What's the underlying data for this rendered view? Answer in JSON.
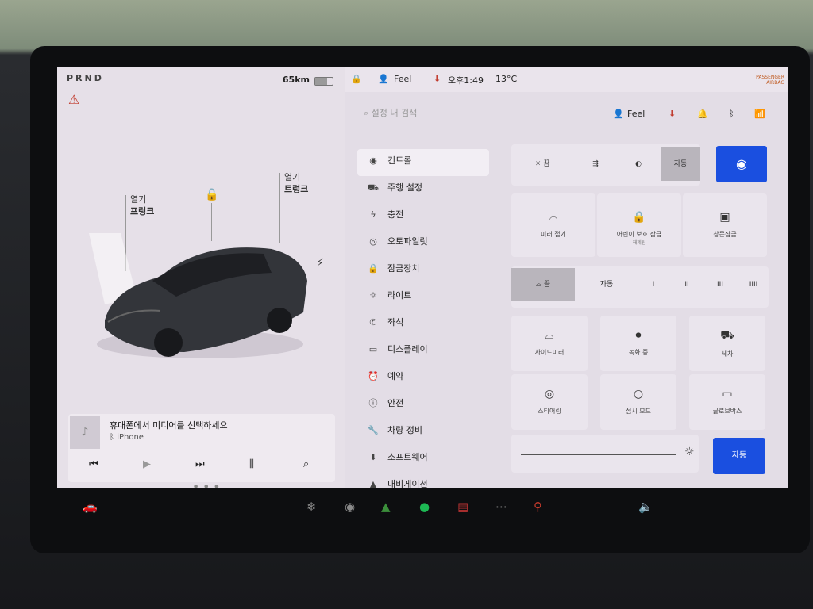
{
  "status": {
    "gear": "PRND",
    "range": "65km"
  },
  "left": {
    "callout_left": {
      "l1": "열기",
      "l2": "프렁크"
    },
    "callout_right": {
      "l1": "열기",
      "l2": "트렁크"
    }
  },
  "media": {
    "title": "휴대폰에서 미디어를 선택하세요",
    "source": "iPhone"
  },
  "topbar": {
    "profile": "Feel",
    "time": "오후1:49",
    "temp": "13°C",
    "airbag_l1": "PASSENGER",
    "airbag_l2": "AIRBAG"
  },
  "search": {
    "placeholder": "설정 내 검색"
  },
  "profile_header": "Feel",
  "menu": [
    {
      "icon": "toggle-icon",
      "label": "컨트롤"
    },
    {
      "icon": "car-icon",
      "label": "주행 설정"
    },
    {
      "icon": "bolt-icon",
      "label": "충전"
    },
    {
      "icon": "steering-icon",
      "label": "오토파일럿"
    },
    {
      "icon": "lock-icon",
      "label": "잠금장치"
    },
    {
      "icon": "sun-icon",
      "label": "라이트"
    },
    {
      "icon": "phone-icon",
      "label": "좌석"
    },
    {
      "icon": "display-icon",
      "label": "디스플레이"
    },
    {
      "icon": "clock-icon",
      "label": "예약"
    },
    {
      "icon": "info-icon",
      "label": "안전"
    },
    {
      "icon": "wrench-icon",
      "label": "차량 정비"
    },
    {
      "icon": "download-icon",
      "label": "소프트웨어"
    },
    {
      "icon": "nav-icon",
      "label": "내비게이션"
    }
  ],
  "lights": {
    "off": "끔",
    "auto": "자동"
  },
  "tiles1": [
    {
      "icon": "mirror-icon",
      "label": "미러 접기",
      "sub": ""
    },
    {
      "icon": "child-lock-icon",
      "label": "어린이 보호 잠금",
      "sub": "해제됨"
    },
    {
      "icon": "window-lock-icon",
      "label": "창문잠금",
      "sub": ""
    }
  ],
  "wipers": {
    "off": "끔",
    "auto": "자동",
    "levels": [
      "I",
      "II",
      "III",
      "IIII"
    ]
  },
  "tiles2": [
    {
      "icon": "side-mirror-icon",
      "label": "사이드미러"
    },
    {
      "icon": "dashcam-icon",
      "label": "녹화 중"
    },
    {
      "icon": "car-wash-icon",
      "label": "세차"
    },
    {
      "icon": "steering-adjust-icon",
      "label": "스티어링"
    },
    {
      "icon": "disabled-icon",
      "label": "접시 모드"
    },
    {
      "icon": "glovebox-icon",
      "label": "글로브박스"
    }
  ],
  "brightness": {
    "value": 0.98,
    "auto_label": "자동"
  }
}
